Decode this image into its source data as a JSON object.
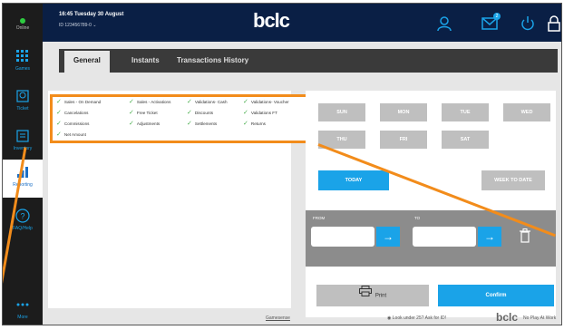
{
  "status": {
    "label": "Online",
    "dot_color": "#2ecc40"
  },
  "header": {
    "time": "16:45 Tuesday 30 August",
    "terminal_id": "ID 123456789-0",
    "logo": "bclc",
    "icons": [
      "user-icon",
      "mail-icon",
      "power-icon",
      "lock-icon"
    ],
    "mail_badge": "2"
  },
  "sidebar": {
    "items": [
      {
        "label": "Games",
        "icon": "grid-icon"
      },
      {
        "label": "Ticket",
        "icon": "scan-icon"
      },
      {
        "label": "Inventory",
        "icon": "inventory-icon"
      },
      {
        "label": "Reporting",
        "icon": "bar-chart-icon",
        "active": true
      },
      {
        "label": "FAQ/Help",
        "icon": "help-icon"
      },
      {
        "label": "More",
        "icon": "more-icon"
      }
    ]
  },
  "tabs": [
    "General",
    "Instants",
    "Transactions History"
  ],
  "filters": [
    "Sales - On Demand",
    "Sales - Activations",
    "Validations- Cash",
    "Validations- Voucher",
    "Cancelations",
    "Free Ticket",
    "Discounts",
    "Validations FT",
    "Commissions",
    "Adjustments",
    "Settlements",
    "Returns",
    "Net Amount"
  ],
  "days": [
    "SUN",
    "MON",
    "TUE",
    "WED",
    "THU",
    "FRI",
    "SAT"
  ],
  "quick": {
    "today": "TODAY",
    "week": "WEEK TO DATE"
  },
  "range": {
    "from": "FROM",
    "to": "TO"
  },
  "actions": {
    "print": "Print",
    "confirm": "Confirm"
  },
  "footer": {
    "center": "Gamesense",
    "right1": "Look under 25? Ask for ID!",
    "right2": "No Play At Work",
    "logo": "bclc"
  },
  "colors": {
    "accent": "#1aa3e8",
    "header": "#0a1f45",
    "highlight": "#f28c1b",
    "check": "#4caf50"
  }
}
